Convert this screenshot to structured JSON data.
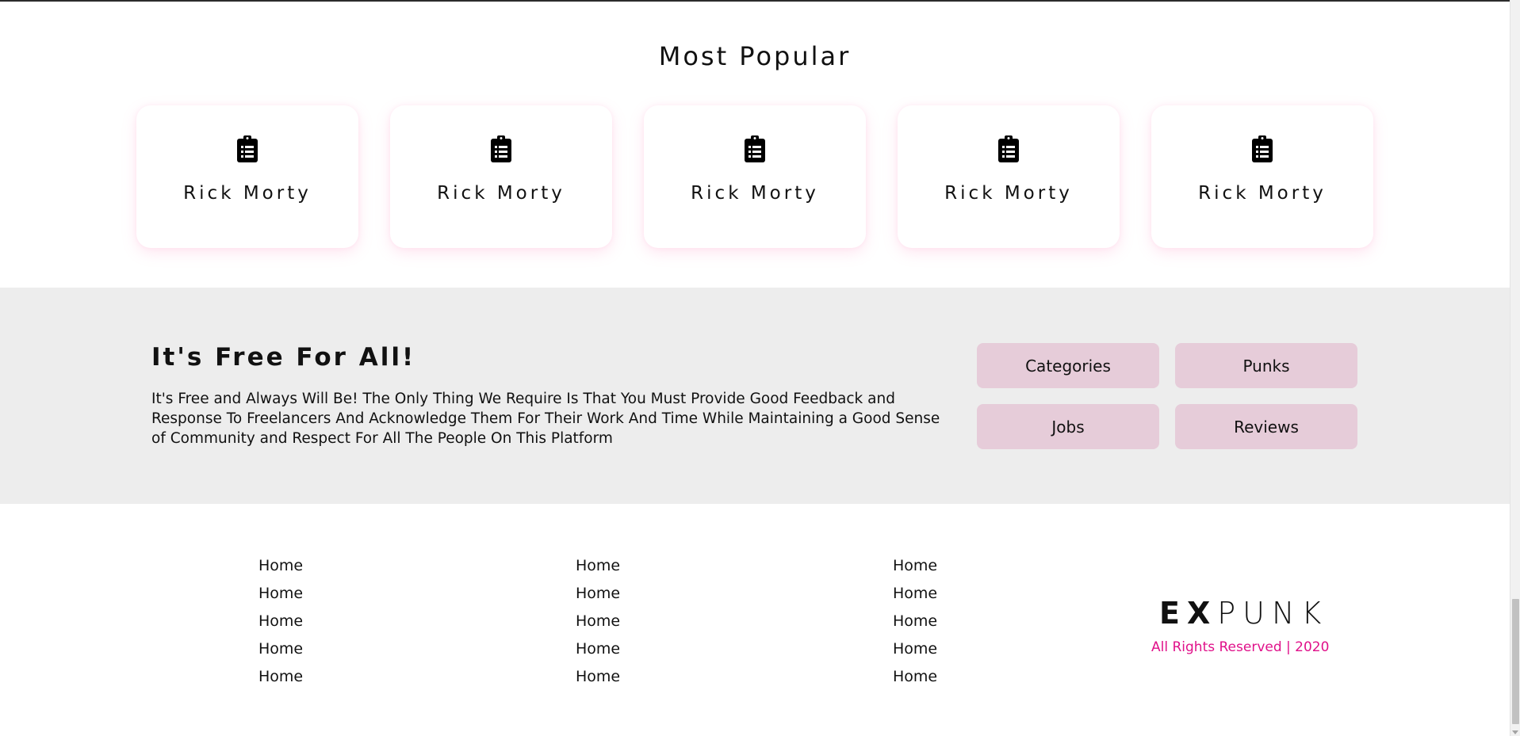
{
  "popular": {
    "title": "Most Popular",
    "cards": [
      {
        "label": "Rick Morty",
        "icon": "clipboard-list-icon"
      },
      {
        "label": "Rick Morty",
        "icon": "clipboard-list-icon"
      },
      {
        "label": "Rick Morty",
        "icon": "clipboard-list-icon"
      },
      {
        "label": "Rick Morty",
        "icon": "clipboard-list-icon"
      },
      {
        "label": "Rick Morty",
        "icon": "clipboard-list-icon"
      }
    ]
  },
  "free": {
    "title": "It's Free For All!",
    "text": "It's Free and Always Will Be! The Only Thing We Require Is That You Must Provide Good Feedback and Response To Freelancers And Acknowledge Them For Their Work And Time While Maintaining a Good Sense of Community and Respect For All The People On This Platform",
    "buttons": [
      "Categories",
      "Punks",
      "Jobs",
      "Reviews"
    ]
  },
  "footer": {
    "columns": [
      [
        "Home",
        "Home",
        "Home",
        "Home",
        "Home"
      ],
      [
        "Home",
        "Home",
        "Home",
        "Home",
        "Home"
      ],
      [
        "Home",
        "Home",
        "Home",
        "Home",
        "Home"
      ]
    ],
    "brand_bold": "EX",
    "brand_light": "PUNK",
    "rights": "All Rights Reserved | 2020"
  },
  "colors": {
    "card_shadow": "#ffc0dc",
    "band_bg": "#ededed",
    "pill_bg": "#e6ccd9",
    "accent": "#e0118a"
  }
}
